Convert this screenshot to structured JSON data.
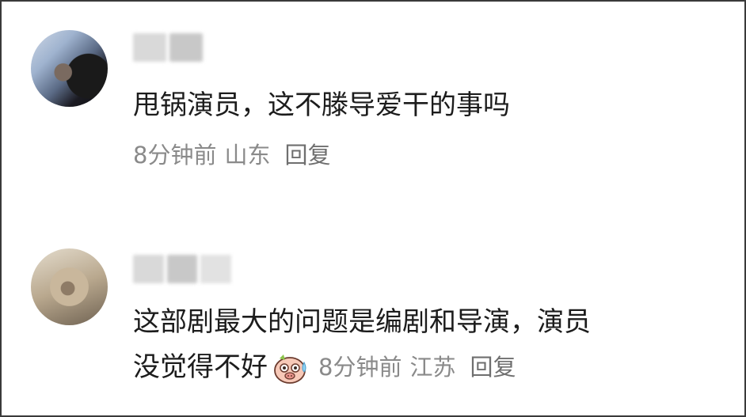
{
  "comments": [
    {
      "text": "甩锅演员，这不滕导爱干的事吗",
      "time": "8分钟前",
      "location": "山东",
      "reply": "回复"
    },
    {
      "text_line1": "这部剧最大的问题是编剧和导演，演员",
      "text_line2": "没觉得不好",
      "emoji": "sweat-smile-pig-emoji",
      "time": "8分钟前",
      "location": "江苏",
      "reply": "回复"
    }
  ]
}
